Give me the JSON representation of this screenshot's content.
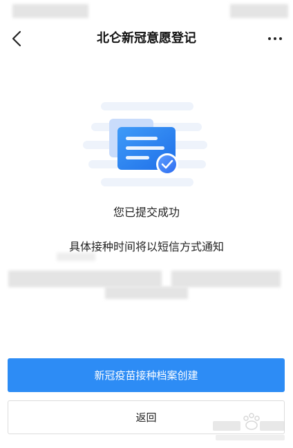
{
  "nav": {
    "title": "北仑新冠意愿登记"
  },
  "icons": {
    "back": "chevron-left-icon",
    "more": "more-horizontal-icon",
    "illustration": "message-submitted-check-icon"
  },
  "result": {
    "title": "您已提交成功",
    "notice": "具体接种时间将以短信方式通知"
  },
  "actions": {
    "primary_label": "新冠疫苗接种档案创建",
    "secondary_label": "返回"
  },
  "colors": {
    "primary": "#2d8cf5",
    "check_badge": "#3b7bf0"
  }
}
